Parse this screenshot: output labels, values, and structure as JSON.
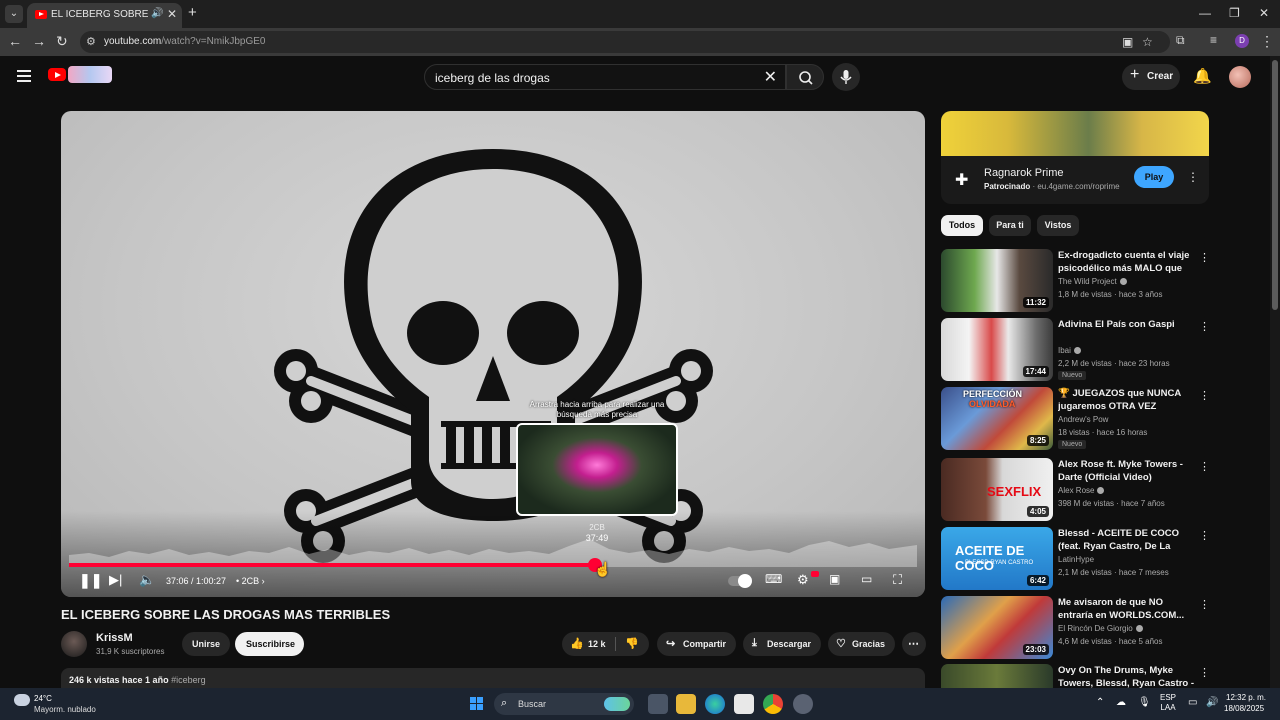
{
  "browser": {
    "tab_title": "EL ICEBERG SOBRE LAS DR",
    "url_host": "youtube.com",
    "url_path": "/watch?v=NmikJbpGE0"
  },
  "youtube": {
    "search_query": "iceberg de las drogas",
    "create_label": "Crear"
  },
  "player": {
    "preview_hint": "Arrastra hacia arriba para realizar una búsqueda más precisa",
    "preview_chapter": "2CB",
    "preview_time": "37:49",
    "time_current_total": "37:06 / 1:00:27",
    "chapter_label": "• 2CB",
    "progress_fraction": 0.62
  },
  "video": {
    "title": "EL ICEBERG SOBRE LAS DROGAS MAS TERRIBLES",
    "channel_name": "KrissM",
    "channel_subs": "31,9 K suscriptores",
    "join_label": "Unirse",
    "subscribe_label": "Suscribirse",
    "likes": "12 k",
    "share_label": "Compartir",
    "download_label": "Descargar",
    "thanks_label": "Gracias",
    "views_date": "246 k vistas  hace 1 año",
    "hashtag": "#iceberg"
  },
  "ad": {
    "title": "Ragnarok Prime",
    "sponsored": "Patrocinado",
    "domain": "· eu.4game.com/roprime",
    "play_label": "Play"
  },
  "chips": [
    "Todos",
    "Para ti",
    "Vistos"
  ],
  "recommendations": [
    {
      "title": "Ex-drogadicto cuenta el viaje psicodélico más MALO que ha...",
      "channel": "The Wild Project",
      "meta": "1,8 M de vistas · hace 3 años",
      "duration": "11:32",
      "badge": ""
    },
    {
      "title": "Adivina El País con Gaspi",
      "channel": "Ibai",
      "meta": "2,2 M de vistas · hace 23 horas",
      "duration": "17:44",
      "badge": "Nuevo"
    },
    {
      "title": "🏆 JUEGAZOS que NUNCA jugaremos OTRA VEZ",
      "channel": "Andrew's Pow",
      "meta": "18 vistas · hace 16 horas",
      "duration": "8:25",
      "badge": "Nuevo"
    },
    {
      "title": "Alex Rose ft. Myke Towers - Darte (Official Video)",
      "channel": "Alex Rose",
      "meta": "398 M de vistas · hace 7 años",
      "duration": "4:05",
      "badge": ""
    },
    {
      "title": "Blessd - ACEITE DE COCO (feat. Ryan Castro, De La Ghetto, ...",
      "channel": "LatinHype",
      "meta": "2,1 M de vistas · hace 7 meses",
      "duration": "6:42",
      "badge": ""
    },
    {
      "title": "Me avisaron de que NO entraría en WORLDS.COM... No les hic...",
      "channel": "El Rincón De Giorgio",
      "meta": "4,6 M de vistas · hace 5 años",
      "duration": "23:03",
      "badge": ""
    },
    {
      "title": "Ovy On The Drums, Myke Towers, Blessd, Ryan Castro - ...",
      "channel": "",
      "meta": "",
      "duration": "",
      "badge": ""
    }
  ],
  "thumb_text": {
    "rec3_line1": "PERFECCIÓN",
    "rec3_line2": "OLVIDADA",
    "rec4_text": "SEXFLIX",
    "rec5_line1": "ACEITE DE COCO",
    "rec5_line2": "BLESSD  RYAN CASTRO"
  },
  "taskbar": {
    "temp": "24°C",
    "weather": "Mayorm. nublado",
    "search_label": "Buscar",
    "lang_1": "ESP",
    "lang_2": "LAA",
    "time": "12:32 p. m.",
    "date": "18/08/2025"
  }
}
